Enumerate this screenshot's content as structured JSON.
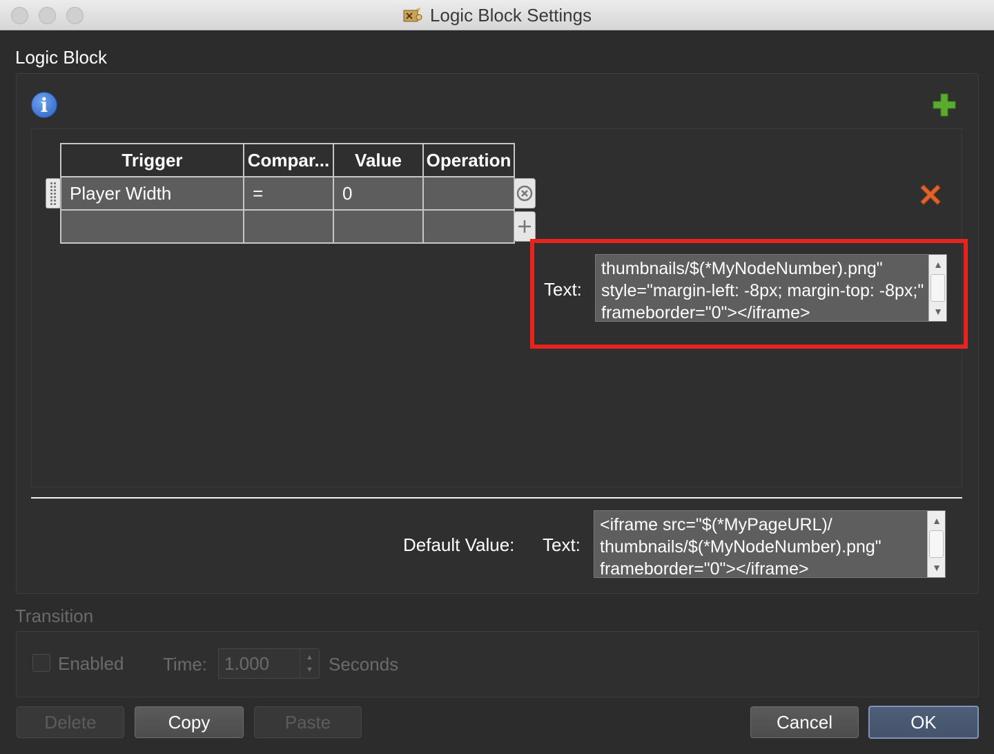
{
  "window": {
    "title": "Logic Block Settings",
    "icon": "app-icon"
  },
  "logic_block": {
    "section_label": "Logic Block",
    "table": {
      "headers": [
        "Trigger",
        "Compar...",
        "Value",
        "Operation"
      ],
      "rows": [
        [
          "Player Width",
          "=",
          "0",
          ""
        ],
        [
          "",
          "",
          "",
          ""
        ]
      ]
    },
    "rule": {
      "text_label": "Text:",
      "text_value": "thumbnails/$(*MyNodeNumber).png\" style=\"margin-left: -8px; margin-top: -8px;\" frameborder=\"0\"></iframe>"
    },
    "default": {
      "label": "Default Value:",
      "text_label": "Text:",
      "text_value": "<iframe src=\"$(*MyPageURL)/ thumbnails/$(*MyNodeNumber).png\" frameborder=\"0\"></iframe>"
    },
    "highlight_color": "#e8221c"
  },
  "transition": {
    "section_label": "Transition",
    "enabled_label": "Enabled",
    "time_label": "Time:",
    "time_value": "1.000",
    "seconds_label": "Seconds"
  },
  "buttons": {
    "delete": "Delete",
    "copy": "Copy",
    "paste": "Paste",
    "cancel": "Cancel",
    "ok": "OK"
  }
}
